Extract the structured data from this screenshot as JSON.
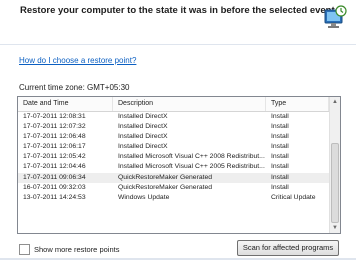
{
  "header": {
    "heading": "Restore your computer to the state it was in before the selected event"
  },
  "help_link": "How do I choose a restore point?",
  "timezone": "Current time zone: GMT+05:30",
  "table": {
    "columns": [
      "Date and Time",
      "Description",
      "Type"
    ],
    "rows": [
      [
        "17-07-2011 12:08:31",
        "Installed DirectX",
        "Install"
      ],
      [
        "17-07-2011 12:07:32",
        "Installed DirectX",
        "Install"
      ],
      [
        "17-07-2011 12:06:48",
        "Installed DirectX",
        "Install"
      ],
      [
        "17-07-2011 12:06:17",
        "Installed DirectX",
        "Install"
      ],
      [
        "17-07-2011 12:05:42",
        "Installed Microsoft Visual C++ 2008 Redistribut...",
        "Install"
      ],
      [
        "17-07-2011 12:04:46",
        "Installed Microsoft Visual C++ 2005 Redistribut...",
        "Install"
      ],
      [
        "17-07-2011 09:06:34",
        "QuickRestoreMaker Generated",
        "Install"
      ],
      [
        "16-07-2011 09:32:03",
        "QuickRestoreMaker Generated",
        "Install"
      ],
      [
        "13-07-2011 14:24:53",
        "Windows Update",
        "Critical Update"
      ]
    ]
  },
  "show_more": "Show more restore points",
  "scan_button": "Scan for affected programs",
  "colors": {
    "link": "#0b5fc2",
    "selected_row": "#eeeeee"
  }
}
